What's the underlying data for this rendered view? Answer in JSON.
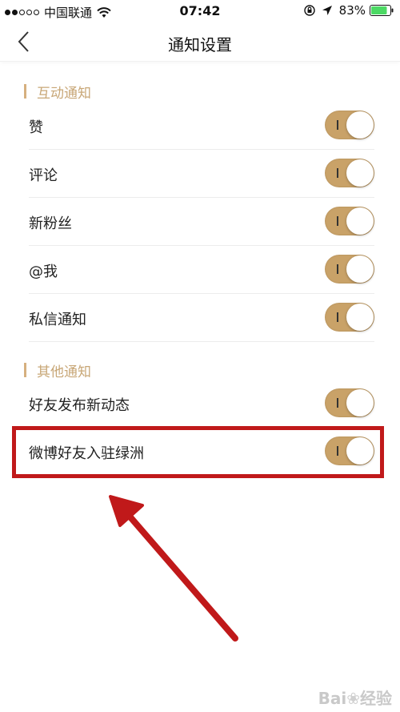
{
  "status_bar": {
    "carrier": "中国联通",
    "time": "07:42",
    "battery": "83%"
  },
  "nav": {
    "title": "通知设置"
  },
  "sections": [
    {
      "title": "互动通知",
      "items": [
        {
          "label": "赞",
          "on": true
        },
        {
          "label": "评论",
          "on": true
        },
        {
          "label": "新粉丝",
          "on": true
        },
        {
          "label": "@我",
          "on": true
        },
        {
          "label": "私信通知",
          "on": true
        }
      ]
    },
    {
      "title": "其他通知",
      "items": [
        {
          "label": "好友发布新动态",
          "on": true
        },
        {
          "label": "微博好友入驻绿洲",
          "on": true
        }
      ]
    }
  ],
  "colors": {
    "accent": "#c9a268",
    "section_title": "#c8a777",
    "highlight": "#c0191a"
  },
  "icons": {
    "back": "chevron-left-icon",
    "wifi": "wifi-icon",
    "lock": "orientation-lock-icon",
    "location": "location-arrow-icon",
    "battery": "battery-icon"
  },
  "watermark": {
    "brand": "Bai",
    "suffix": "经验"
  }
}
